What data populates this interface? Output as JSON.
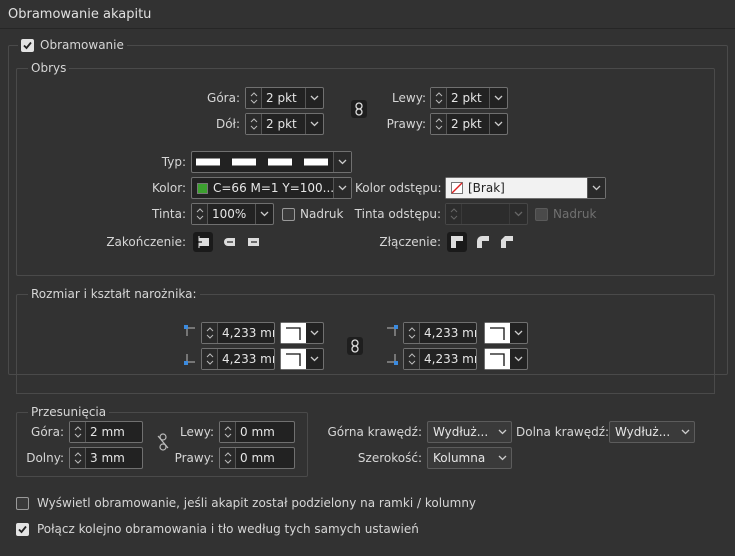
{
  "panel": {
    "title": "Obramowanie akapitu"
  },
  "enable": {
    "label": "Obramowanie",
    "checked": true
  },
  "obrys": {
    "legend": "Obrys",
    "gora": {
      "label": "Góra:",
      "value": "2 pkt"
    },
    "dol": {
      "label": "Dół:",
      "value": "2 pkt"
    },
    "lewy": {
      "label": "Lewy:",
      "value": "2 pkt"
    },
    "prawy": {
      "label": "Prawy:",
      "value": "2 pkt"
    },
    "typ_label": "Typ:",
    "kolor_label": "Kolor:",
    "kolor_value": "C=66 M=1 Y=100...",
    "kolor_swatch": "#3ca02f",
    "kolor_odstepu_label": "Kolor odstępu:",
    "kolor_odstepu_value": "[Brak]",
    "tinta_label": "Tinta:",
    "tinta_value": "100%",
    "nadruk_label": "Nadruk",
    "tinta_odstepu_label": "Tinta odstępu:",
    "nadruk2_label": "Nadruk",
    "zakonczenie_label": "Zakończenie:",
    "zlaczenie_label": "Złączenie:"
  },
  "corners": {
    "legend": "Rozmiar i kształt narożnika:",
    "tl_value": "4,233 mı",
    "bl_value": "4,233 mı",
    "tr_value": "4,233 mı",
    "br_value": "4,233 mı"
  },
  "offsets": {
    "legend": "Przesunięcia",
    "gora": {
      "label": "Góra:",
      "value": "2 mm"
    },
    "dolny": {
      "label": "Dolny:",
      "value": "3 mm"
    },
    "lewy": {
      "label": "Lewy:",
      "value": "0 mm"
    },
    "prawy": {
      "label": "Prawy:",
      "value": "0 mm"
    }
  },
  "edges": {
    "gorna_label": "Górna krawędź:",
    "gorna_value": "Wydłuż...",
    "dolna_label": "Dolna krawędź:",
    "dolna_value": "Wydłuż...",
    "szerokosc_label": "Szerokość:",
    "szerokosc_value": "Kolumna"
  },
  "options": {
    "split_label": "Wyświetl obramowanie, jeśli akapit został podzielony na ramki / kolumny",
    "split_checked": false,
    "merge_label": "Połącz kolejno obramowania i tło według tych samych ustawień",
    "merge_checked": true
  },
  "colors": {
    "accent_corner_icon": "#3b8be0"
  }
}
